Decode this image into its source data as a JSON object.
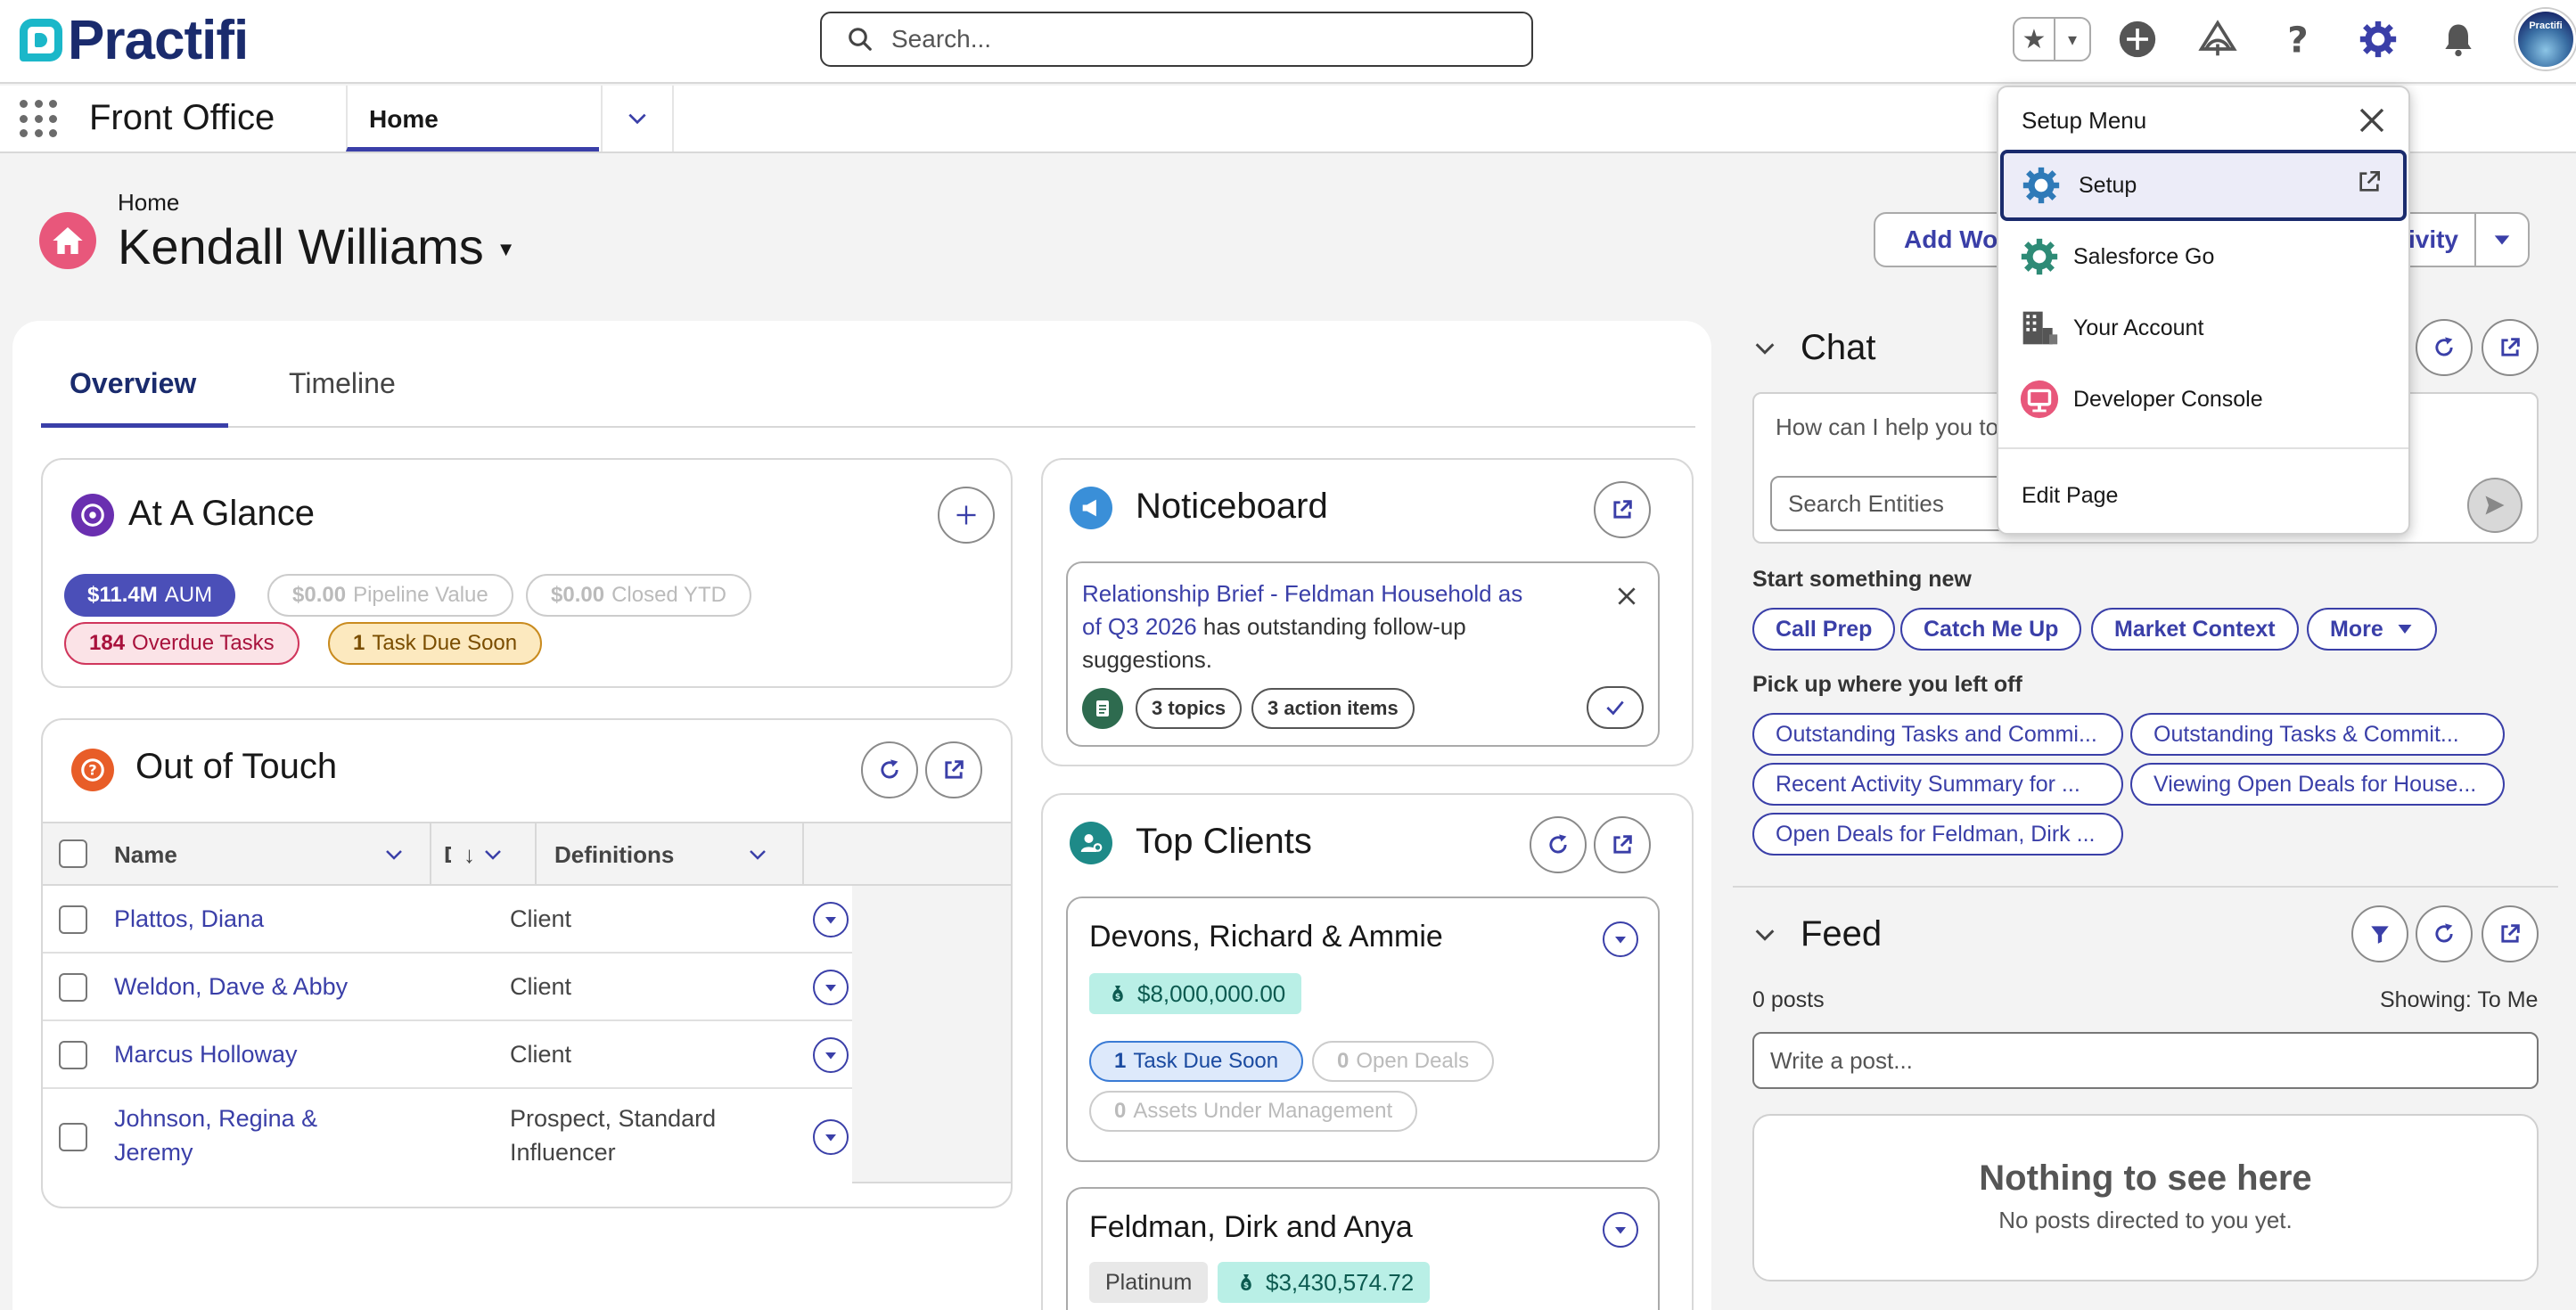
{
  "header": {
    "logo_text": "Practifi",
    "search_placeholder": "Search...",
    "avatar_label": "Practifi"
  },
  "nav": {
    "app_name": "Front Office",
    "tab_label": "Home"
  },
  "page": {
    "breadcrumb": "Home",
    "title": "Kendall Williams",
    "add_work_button": "Add Work",
    "activity_button": "Log Activity"
  },
  "tabs": [
    "Overview",
    "Timeline"
  ],
  "at_a_glance": {
    "title": "At A Glance",
    "badges": [
      {
        "value": "$11.4M",
        "label": "AUM"
      },
      {
        "value": "$0.00",
        "label": "Pipeline Value"
      },
      {
        "value": "$0.00",
        "label": "Closed YTD"
      },
      {
        "value": "184",
        "label": "Overdue Tasks"
      },
      {
        "value": "1",
        "label": "Task Due Soon"
      }
    ]
  },
  "out_of_touch": {
    "title": "Out of Touch",
    "columns": [
      "Name",
      "D",
      "Definitions"
    ],
    "rows": [
      {
        "name": "Plattos, Diana",
        "definitions": "Client"
      },
      {
        "name": "Weldon, Dave & Abby",
        "definitions": "Client"
      },
      {
        "name": "Marcus Holloway",
        "definitions": "Client"
      },
      {
        "name_line1": "Johnson, Regina &",
        "name_line2": "Jeremy",
        "def_line1": "Prospect, Standard",
        "def_line2": "Influencer"
      }
    ]
  },
  "noticeboard": {
    "title": "Noticeboard",
    "note_link_line1": "Relationship Brief - Feldman Household as",
    "note_link_line2": "of Q3 2026",
    "note_text_line2": " has outstanding follow-up",
    "note_text_line3": "suggestions.",
    "chip_topics": "3 topics",
    "chip_actions": "3 action items"
  },
  "top_clients": {
    "title": "Top Clients",
    "clients": [
      {
        "name": "Devons, Richard & Ammie",
        "amount": "$8,000,000.00",
        "badges": [
          {
            "value": "1",
            "label": "Task Due Soon"
          },
          {
            "value": "0",
            "label": "Open Deals"
          },
          {
            "value": "0",
            "label": "Assets Under Management"
          }
        ]
      },
      {
        "name": "Feldman, Dirk and Anya",
        "tier": "Platinum",
        "amount": "$3,430,574.72"
      }
    ]
  },
  "chat": {
    "title": "Chat",
    "input_placeholder": "How can I help you today?",
    "entity_placeholder": "Search Entities",
    "start_label": "Start something new",
    "start_chips": [
      "Call Prep",
      "Catch Me Up",
      "Market Context",
      "More"
    ],
    "resume_label": "Pick up where you left off",
    "resume_chips": [
      "Outstanding Tasks and Commi...",
      "Outstanding Tasks & Commit...",
      "Recent Activity Summary for ...",
      "Viewing Open Deals for House...",
      "Open Deals for Feldman, Dirk ..."
    ]
  },
  "feed": {
    "title": "Feed",
    "post_count": "0 posts",
    "showing": "Showing: To Me",
    "post_placeholder": "Write a post...",
    "empty_title": "Nothing to see here",
    "empty_sub": "No posts directed to you yet."
  },
  "setup_menu": {
    "title": "Setup Menu",
    "items": [
      "Setup",
      "Salesforce Go",
      "Your Account",
      "Developer Console"
    ],
    "edit_page": "Edit Page"
  },
  "colors": {
    "brand_navy": "#1a2b6d",
    "link_blue": "#3a3fa8",
    "teal": "#1bb7c9",
    "home_pink": "#e8577b"
  }
}
